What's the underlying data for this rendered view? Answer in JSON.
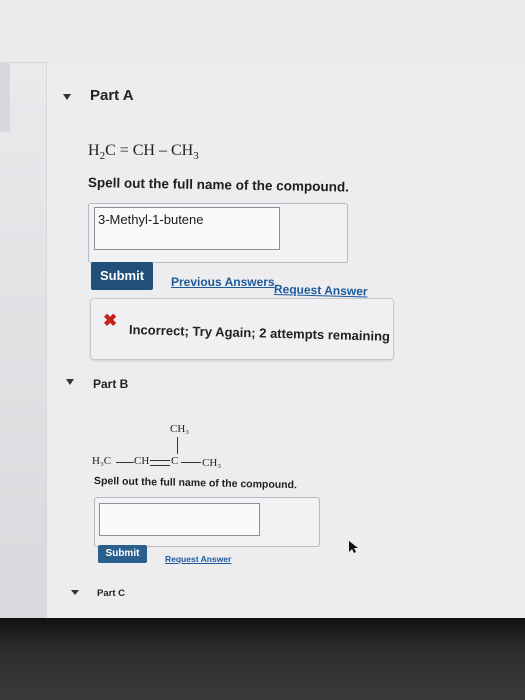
{
  "part_a": {
    "title": "Part A",
    "formula": {
      "h": "H",
      "h_sub": "2",
      "c_eq": "C = CH – CH",
      "ch_sub": "3"
    },
    "instruction": "Spell out the full name of the compound.",
    "answer_value": "3-Methyl-1-butene",
    "submit_label": "Submit",
    "previous_answers_label": "Previous Answers",
    "request_answer_label": "Request Answer",
    "feedback": {
      "text": "Incorrect; Try Again; 2 attempts remaining",
      "icon": "close-x-icon",
      "icon_color": "#c8211b"
    }
  },
  "part_b": {
    "title": "Part B",
    "structure": {
      "top_group": "CH₃",
      "left": "H₃C",
      "middle": "CH",
      "carbon": "C",
      "right": "CH₃"
    },
    "instruction": "Spell out the full name of the compound.",
    "answer_value": "",
    "submit_label": "Submit",
    "request_answer_label": "Request Answer"
  },
  "part_c": {
    "title": "Part C"
  },
  "colors": {
    "submit_bg": "#1f4f7a",
    "link": "#1c5a9c"
  }
}
